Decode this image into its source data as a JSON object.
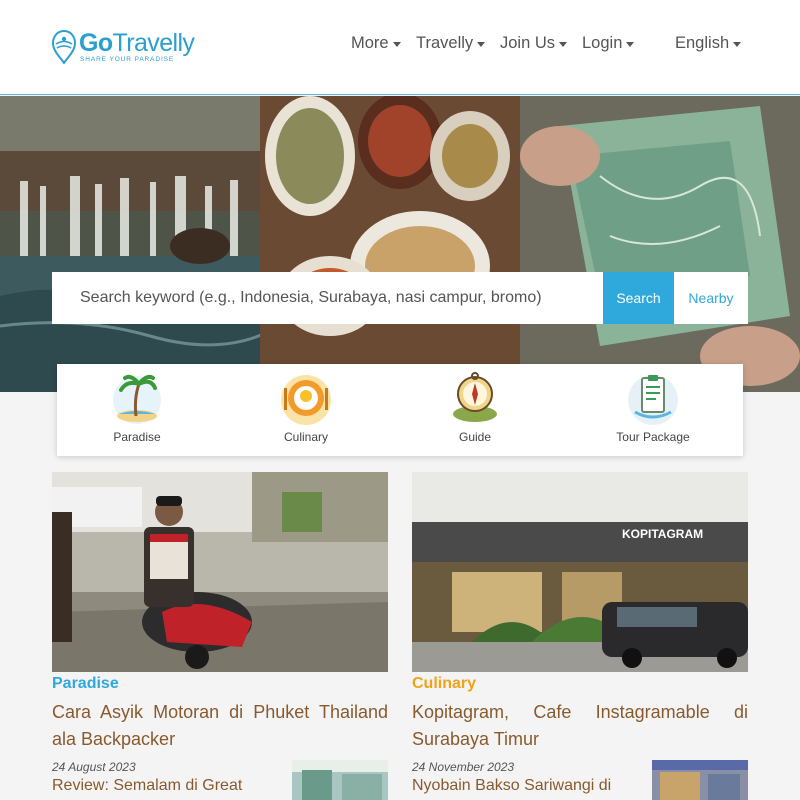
{
  "brand": {
    "name_bold": "Go",
    "name_rest": "Travelly",
    "tagline": "SHARE YOUR PARADISE",
    "color": "#2a9fd0"
  },
  "nav": {
    "more": "More",
    "travelly": "Travelly",
    "join": "Join Us",
    "login": "Login",
    "language": "English"
  },
  "search": {
    "placeholder": "Search keyword (e.g., Indonesia, Surabaya, nasi campur, bromo)",
    "search_label": "Search",
    "nearby_label": "Nearby",
    "accent": "#2fa8dc"
  },
  "categories": [
    {
      "label": "Paradise",
      "icon": "palm-island-icon"
    },
    {
      "label": "Culinary",
      "icon": "food-plate-icon"
    },
    {
      "label": "Guide",
      "icon": "compass-icon"
    },
    {
      "label": "Tour Package",
      "icon": "clipboard-icon"
    }
  ],
  "articles": [
    {
      "category": "Paradise",
      "category_color": "#2fa8dc",
      "title": "Cara Asyik Motoran di Phuket Thailand ala Backpacker",
      "sub_date": "24 August 2023",
      "sub_title": "Review: Semalam di Great"
    },
    {
      "category": "Culinary",
      "category_color": "#f0a21a",
      "title": "Kopitagram, Cafe Instagramable di Surabaya Timur",
      "sign_text": "KOPITAGRAM",
      "sub_date": "24 November 2023",
      "sub_title": "Nyobain Bakso Sariwangi di"
    }
  ]
}
